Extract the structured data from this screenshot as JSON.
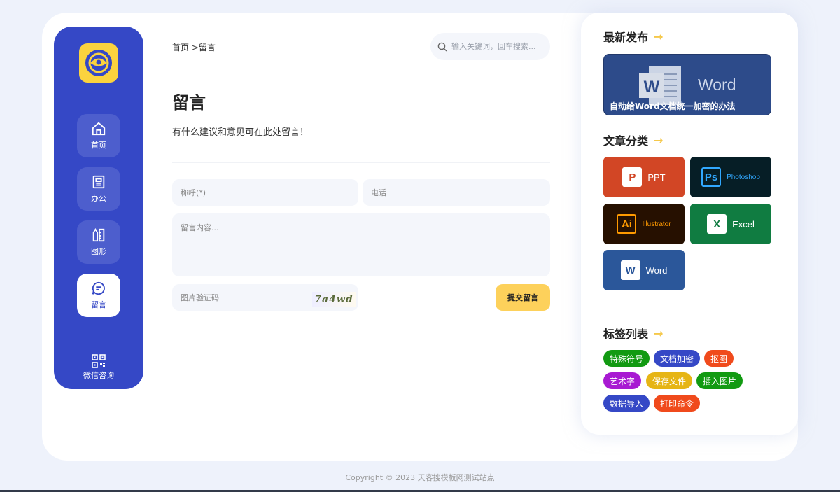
{
  "sidebar": {
    "items": [
      {
        "label": "首页",
        "icon": "home-icon"
      },
      {
        "label": "办公",
        "icon": "document-icon"
      },
      {
        "label": "图形",
        "icon": "graphics-icon"
      },
      {
        "label": "留言",
        "icon": "message-icon",
        "active": true
      }
    ],
    "wechat_label": "微信咨询"
  },
  "header": {
    "breadcrumb": "首页 >留言",
    "search_placeholder": "输入关键词，回车搜索..."
  },
  "main": {
    "title": "留言",
    "description": "有什么建议和意见可在此处留言！",
    "form": {
      "name_placeholder": "称呼(*)",
      "phone_placeholder": "电话",
      "content_placeholder": "留言内容...",
      "captcha_placeholder": "图片验证码",
      "captcha_text": "7a4wd",
      "submit_label": "提交留言"
    }
  },
  "right": {
    "latest_title": "最新发布",
    "latest_article": {
      "image_text": "Word",
      "title": "自动给Word文档统一加密的办法"
    },
    "categories_title": "文章分类",
    "categories": [
      {
        "name": "PPT",
        "icon_text": "P",
        "bg": "#d24625",
        "icon_bg": "#ffffff",
        "icon_fg": "#d24625",
        "fg": "#ffffff"
      },
      {
        "name": "Photoshop",
        "icon_text": "Ps",
        "bg": "#061e26",
        "icon_bg": "#061e26",
        "icon_fg": "#31a8ff",
        "fg": "#31a8ff"
      },
      {
        "name": "Illustrator",
        "icon_text": "Ai",
        "bg": "#261000",
        "icon_bg": "#261000",
        "icon_fg": "#ff9a00",
        "fg": "#ff9a00"
      },
      {
        "name": "Excel",
        "icon_text": "X",
        "bg": "#107c41",
        "icon_bg": "#ffffff",
        "icon_fg": "#107c41",
        "fg": "#ffffff"
      },
      {
        "name": "Word",
        "icon_text": "W",
        "bg": "#2b579a",
        "icon_bg": "#ffffff",
        "icon_fg": "#2b579a",
        "fg": "#ffffff"
      }
    ],
    "tags_title": "标签列表",
    "tags": [
      {
        "label": "特殊符号",
        "color": "#129a12"
      },
      {
        "label": "文档加密",
        "color": "#3548c6"
      },
      {
        "label": "抠图",
        "color": "#f04a1c"
      },
      {
        "label": "艺术字",
        "color": "#a81ad2"
      },
      {
        "label": "保存文件",
        "color": "#e6b515"
      },
      {
        "label": "插入图片",
        "color": "#129a12"
      },
      {
        "label": "数据导入",
        "color": "#3548c6"
      },
      {
        "label": "打印命令",
        "color": "#f04a1c"
      }
    ]
  },
  "footer": {
    "copyright": "Copyright © 2023 天客搜模板网测试站点"
  },
  "colors": {
    "primary": "#3548c6",
    "accent": "#fdd15b",
    "field_bg": "#f4f6fb"
  }
}
